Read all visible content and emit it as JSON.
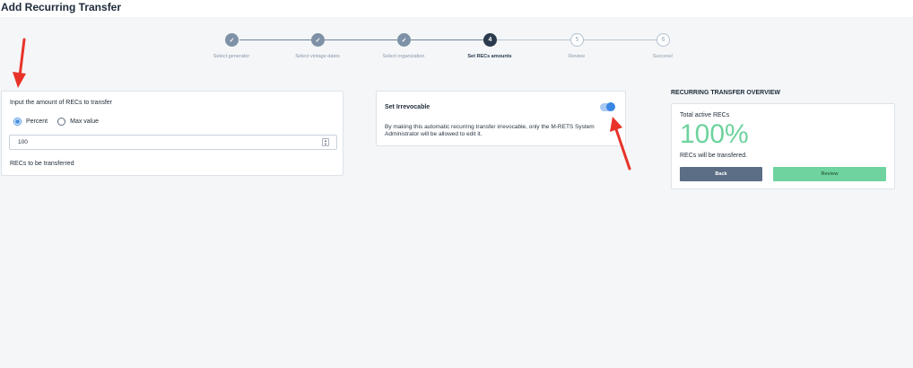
{
  "page": {
    "title": "Add Recurring Transfer"
  },
  "stepper": {
    "steps": [
      {
        "label": "Select generator",
        "status": "done",
        "marker": "✓"
      },
      {
        "label": "Select vintage dates",
        "status": "done",
        "marker": "✓"
      },
      {
        "label": "Select organization",
        "status": "done",
        "marker": "✓"
      },
      {
        "label": "Set RECs amounts",
        "status": "active",
        "marker": "4"
      },
      {
        "label": "Review",
        "status": "pending",
        "marker": "5"
      },
      {
        "label": "Success!",
        "status": "pending",
        "marker": "6"
      }
    ]
  },
  "amount": {
    "title": "Input the amount of RECs to transfer",
    "options": [
      {
        "label": "Percent",
        "checked": true
      },
      {
        "label": "Max value",
        "checked": false
      }
    ],
    "input_value": "100",
    "footer": "RECs to be transferred"
  },
  "irrevocable": {
    "title": "Set Irrevocable",
    "enabled": true,
    "description": "By making this automatic recurring transfer irrevocable, only the M-RETS System Administrator will be allowed to edit it."
  },
  "overview": {
    "heading": "RECURRING TRANSFER OVERVIEW",
    "total_label": "Total active RECs",
    "total_value": "100%",
    "note": "RECs will be transfered.",
    "back_label": "Back",
    "review_label": "Review"
  },
  "colors": {
    "accent_blue": "#3a86e5",
    "success_green": "#6ed39e",
    "slate_button": "#5b6e85",
    "annotation_red": "#e8332a"
  },
  "icons": {
    "completed_step": "check-icon",
    "annotation": "red-arrow-icon"
  }
}
